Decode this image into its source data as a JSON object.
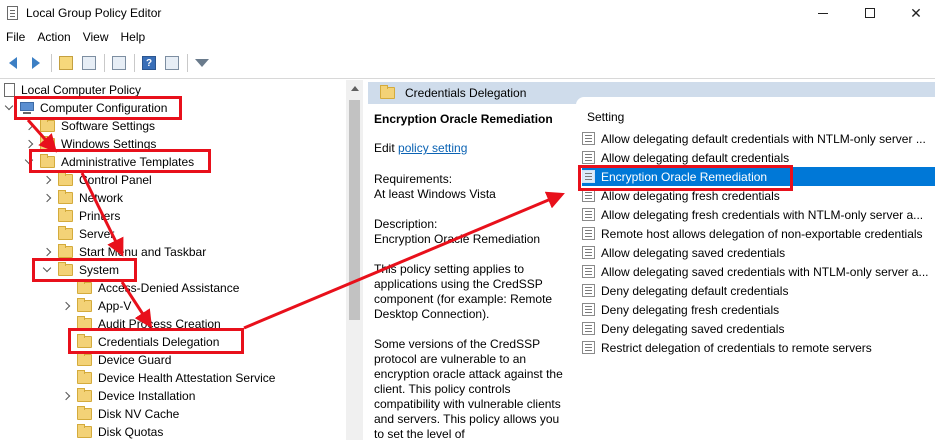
{
  "window": {
    "title": "Local Group Policy Editor"
  },
  "menu": {
    "file": "File",
    "action": "Action",
    "view": "View",
    "help": "Help"
  },
  "tree": {
    "root": "Local Computer Policy",
    "computer_config": "Computer Configuration",
    "software_settings": "Software Settings",
    "windows_settings": "Windows Settings",
    "admin_templates": "Administrative Templates",
    "control_panel": "Control Panel",
    "network": "Network",
    "printers": "Printers",
    "server": "Server",
    "start_menu": "Start Menu and Taskbar",
    "system": "System",
    "access_denied": "Access-Denied Assistance",
    "app_v": "App-V",
    "audit_process": "Audit Process Creation",
    "credentials_delegation": "Credentials Delegation",
    "device_guard": "Device Guard",
    "device_health": "Device Health Attestation Service",
    "device_installation": "Device Installation",
    "disk_nv_cache": "Disk NV Cache",
    "disk_quotas": "Disk Quotas"
  },
  "header": {
    "folder_title": "Credentials Delegation"
  },
  "description": {
    "title": "Encryption Oracle Remediation",
    "edit_prefix": "Edit ",
    "edit_link": "policy setting",
    "requirements_label": "Requirements:",
    "requirements_value": "At least Windows Vista",
    "description_label": "Description:",
    "description_value": "Encryption Oracle Remediation",
    "para1": "This policy setting applies to applications using the CredSSP component (for example: Remote Desktop Connection).",
    "para2": "Some versions of the CredSSP protocol are vulnerable to an encryption oracle attack against the client.  This policy controls compatibility with vulnerable clients and servers.  This policy allows you to set the level of"
  },
  "settings": {
    "column_header": "Setting",
    "items": [
      "Allow delegating default credentials with NTLM-only server ...",
      "Allow delegating default credentials",
      "Encryption Oracle Remediation",
      "Allow delegating fresh credentials",
      "Allow delegating fresh credentials with NTLM-only server a...",
      "Remote host allows delegation of non-exportable credentials",
      "Allow delegating saved credentials",
      "Allow delegating saved credentials with NTLM-only server a...",
      "Deny delegating default credentials",
      "Deny delegating fresh credentials",
      "Deny delegating saved credentials",
      "Restrict delegation of credentials to remote servers"
    ],
    "selected_index": 2
  },
  "colors": {
    "annotation_red": "#e8101b",
    "selection_blue": "#0078d7",
    "header_blue": "#cfdceb"
  }
}
